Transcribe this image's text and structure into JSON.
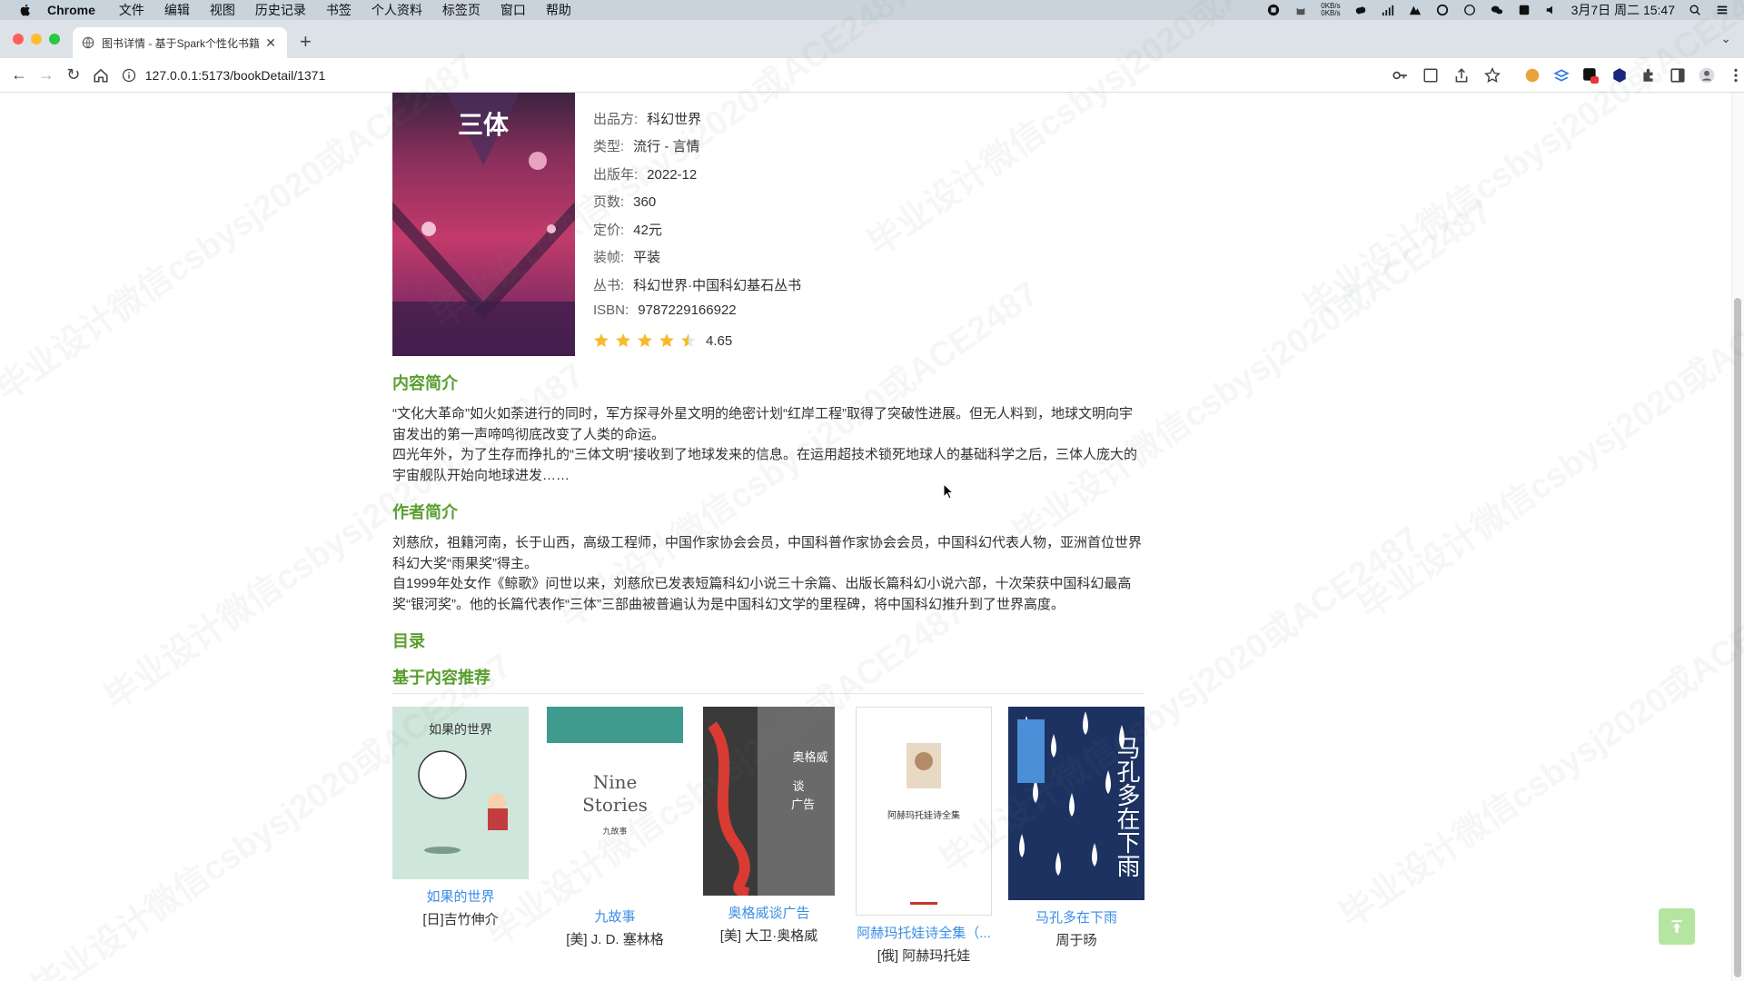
{
  "menubar": {
    "app_name": "Chrome",
    "menus": [
      "文件",
      "编辑",
      "视图",
      "历史记录",
      "书签",
      "个人资料",
      "标签页",
      "窗口",
      "帮助"
    ],
    "net_up": "0KB/s",
    "net_down": "0KB/s",
    "datetime": "3月7日 周二  15:47"
  },
  "browser": {
    "tab_title": "图书详情 - 基于Spark个性化书籍",
    "url": "127.0.0.1:5173/bookDetail/1371"
  },
  "book": {
    "cover_title": "三体",
    "info_rows": [
      {
        "key": "出品方:",
        "value": "科幻世界"
      },
      {
        "key": "类型:",
        "value": "流行 - 言情"
      },
      {
        "key": "出版年:",
        "value": "2022-12"
      },
      {
        "key": "页数:",
        "value": "360"
      },
      {
        "key": "定价:",
        "value": "42元"
      },
      {
        "key": "装帧:",
        "value": "平装"
      },
      {
        "key": "丛书:",
        "value": "科幻世界·中国科幻基石丛书"
      },
      {
        "key": "ISBN:",
        "value": "9787229166922"
      }
    ],
    "rating": "4.65",
    "rating_value": 4.65,
    "star_color": "#f7ba2a"
  },
  "sections": {
    "summary_title": "内容简介",
    "summary_p1": "“文化大革命”如火如荼进行的同时，军方探寻外星文明的绝密计划“红岸工程”取得了突破性进展。但无人料到，地球文明向宇宙发出的第一声啼鸣彻底改变了人类的命运。",
    "summary_p2": "四光年外，为了生存而挣扎的“三体文明”接收到了地球发来的信息。在运用超技术锁死地球人的基础科学之后，三体人庞大的宇宙舰队开始向地球进发……",
    "author_title": "作者简介",
    "author_p1": "刘慈欣，祖籍河南，长于山西，高级工程师，中国作家协会会员，中国科普作家协会会员，中国科幻代表人物，亚洲首位世界科幻大奖“雨果奖”得主。",
    "author_p2": "自1999年处女作《鲸歌》问世以来，刘慈欣已发表短篇科幻小说三十余篇、出版长篇科幻小说六部，十次荣获中国科幻最高奖“银河奖”。他的长篇代表作“三体”三部曲被普遍认为是中国科幻文学的里程碑，将中国科幻推升到了世界高度。",
    "toc_title": "目录",
    "rec_title": "基于内容推荐"
  },
  "recommendations": [
    {
      "title": "如果的世界",
      "author": "[日]吉竹伸介",
      "cover_text": "如果的世界"
    },
    {
      "title": "九故事",
      "author": "[美] J. D. 塞林格",
      "cover_text_1": "Nine",
      "cover_text_2": "Stories",
      "cover_text_3": "九故事"
    },
    {
      "title": "奥格威谈广告",
      "author": "[美] 大卫·奥格威",
      "cover_text_1": "奥格威",
      "cover_text_2": "谈",
      "cover_text_3": "广告"
    },
    {
      "title": "阿赫玛托娃诗全集（...",
      "author": "[俄] 阿赫玛托娃",
      "cover_text": "阿赫玛托娃诗全集"
    },
    {
      "title": "马孔多在下雨",
      "author": "周于旸",
      "cover_text": "马孔多在下雨"
    }
  ],
  "watermark": "毕业设计微信csbysj2020或ACE2487"
}
